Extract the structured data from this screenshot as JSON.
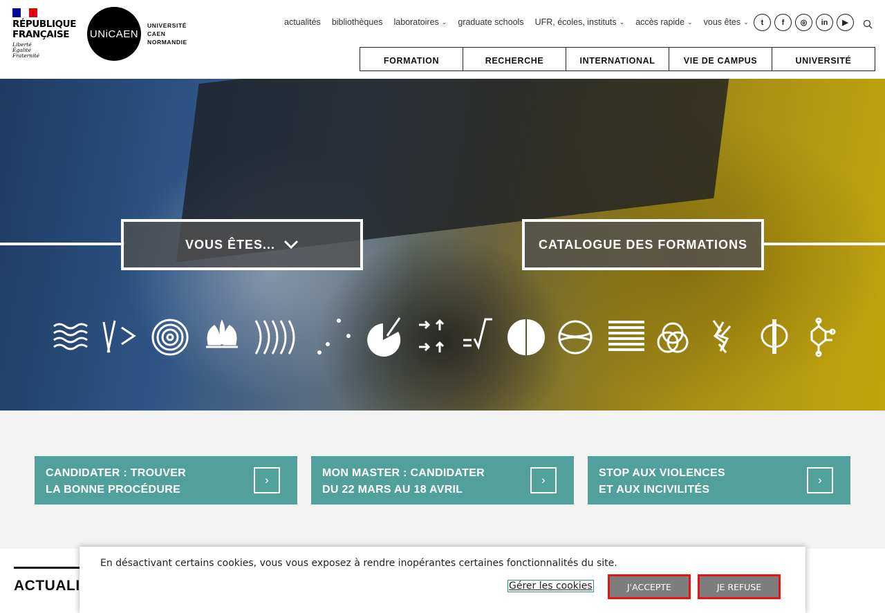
{
  "header": {
    "rf": {
      "title": "RÉPUBLIQUE\nFRANÇAISE",
      "motto": "Liberté\nÉgalité\nFraternité",
      "flag_colors": [
        "#000091",
        "#ffffff",
        "#e1000f"
      ]
    },
    "unicaen": {
      "circle_text": "UNiCAEN",
      "name": "UNIVERSITÉ\nCAEN\nNORMANDIE"
    },
    "topnav": [
      {
        "label": "actualités",
        "dropdown": false
      },
      {
        "label": "bibliothèques",
        "dropdown": false
      },
      {
        "label": "laboratoires",
        "dropdown": true
      },
      {
        "label": "graduate schools",
        "dropdown": false
      },
      {
        "label": "UFR, écoles, instituts",
        "dropdown": true
      },
      {
        "label": "accès rapide",
        "dropdown": true
      },
      {
        "label": "vous êtes",
        "dropdown": true
      }
    ],
    "socials": [
      {
        "icon": "twitter-icon",
        "glyph": "t"
      },
      {
        "icon": "facebook-icon",
        "glyph": "f"
      },
      {
        "icon": "instagram-icon",
        "glyph": "◎"
      },
      {
        "icon": "linkedin-icon",
        "glyph": "in"
      },
      {
        "icon": "youtube-icon",
        "glyph": "▶"
      }
    ],
    "search_icon": "search-icon",
    "mainnav": [
      "FORMATION",
      "RECHERCHE",
      "INTERNATIONAL",
      "VIE DE CAMPUS",
      "UNIVERSITÉ"
    ]
  },
  "hero": {
    "vous_etes": "VOUS ÊTES...",
    "catalogue": "CATALOGUE DES FORMATIONS",
    "chevron_icon": "chevron-down-icon",
    "discipline_icons": [
      "waves-icon",
      "code-icon",
      "target-icon",
      "lotus-icon",
      "sound-waves-icon",
      "dots-icon",
      "pie-chart-icon",
      "arrows-icon",
      "equals-sqrt-icon",
      "half-circles-icon",
      "globe-icon",
      "binary-icon",
      "venn-icon",
      "molecule-cross-icon",
      "phi-icon",
      "chemistry-icon"
    ]
  },
  "quick_links": [
    {
      "text": "CANDIDATER : TROUVER\nLA BONNE PROCÉDURE",
      "arrow": "›"
    },
    {
      "text": "MON MASTER : CANDIDATER\nDU 22 MARS AU 18 AVRIL",
      "arrow": "›"
    },
    {
      "text": "STOP AUX VIOLENCES\nET AUX INCIVILITÉS",
      "arrow": "›"
    }
  ],
  "accent_color": "#52a09c",
  "news": {
    "title": "ACTUALITÉS"
  },
  "cookie": {
    "text": "En désactivant certains cookies, vous vous exposez à rendre inopérantes certaines fonctionnalités du site.",
    "manage": "Gérer les cookies",
    "accept": "J'ACCEPTE",
    "refuse": "JE REFUSE"
  }
}
